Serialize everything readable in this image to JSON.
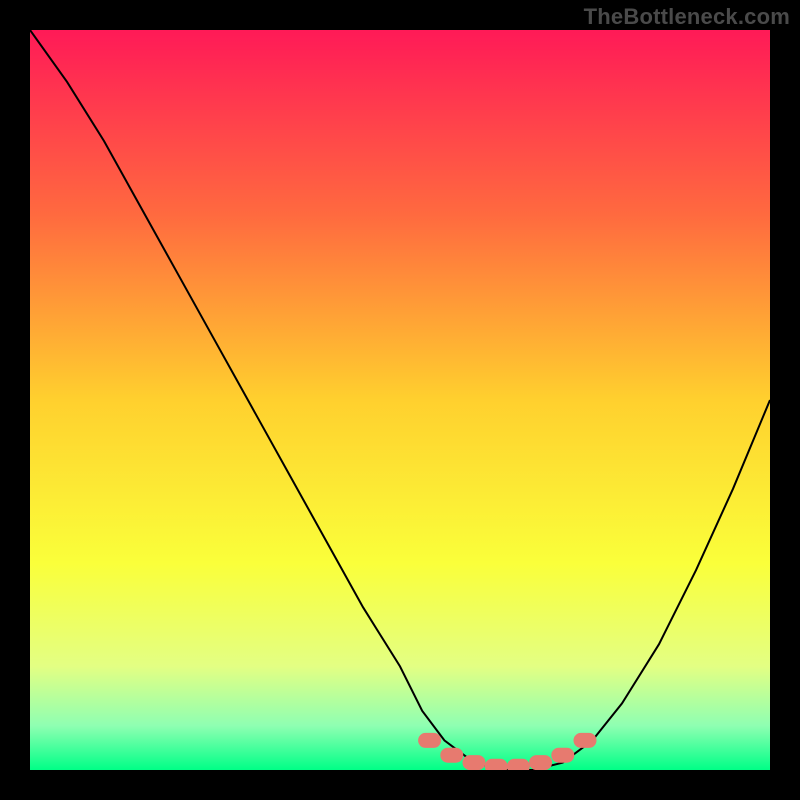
{
  "watermark": "TheBottleneck.com",
  "chart_data": {
    "type": "line",
    "title": "",
    "xlabel": "",
    "ylabel": "",
    "xlim": [
      0,
      100
    ],
    "ylim": [
      0,
      100
    ],
    "grid": false,
    "legend": false,
    "series": [
      {
        "name": "curve",
        "x": [
          0,
          5,
          10,
          15,
          20,
          25,
          30,
          35,
          40,
          45,
          50,
          53,
          56,
          60,
          64,
          68,
          72,
          76,
          80,
          85,
          90,
          95,
          100
        ],
        "y": [
          100,
          93,
          85,
          76,
          67,
          58,
          49,
          40,
          31,
          22,
          14,
          8,
          4,
          1,
          0,
          0,
          1,
          4,
          9,
          17,
          27,
          38,
          50
        ]
      }
    ],
    "markers": {
      "name": "bottom-cluster",
      "x": [
        54,
        57,
        60,
        63,
        66,
        69,
        72,
        75
      ],
      "y": [
        4,
        2,
        1,
        0.5,
        0.5,
        1,
        2,
        4
      ]
    },
    "background_gradient": {
      "stops": [
        {
          "offset": 0.0,
          "color": "#ff1a57"
        },
        {
          "offset": 0.25,
          "color": "#ff6a3f"
        },
        {
          "offset": 0.5,
          "color": "#ffd02e"
        },
        {
          "offset": 0.72,
          "color": "#faff3a"
        },
        {
          "offset": 0.86,
          "color": "#e3ff83"
        },
        {
          "offset": 0.94,
          "color": "#8fffb2"
        },
        {
          "offset": 1.0,
          "color": "#00ff87"
        }
      ]
    },
    "colors": {
      "curve": "#000000",
      "marker_fill": "#e77a6f",
      "marker_stroke": "#e77a6f"
    }
  }
}
